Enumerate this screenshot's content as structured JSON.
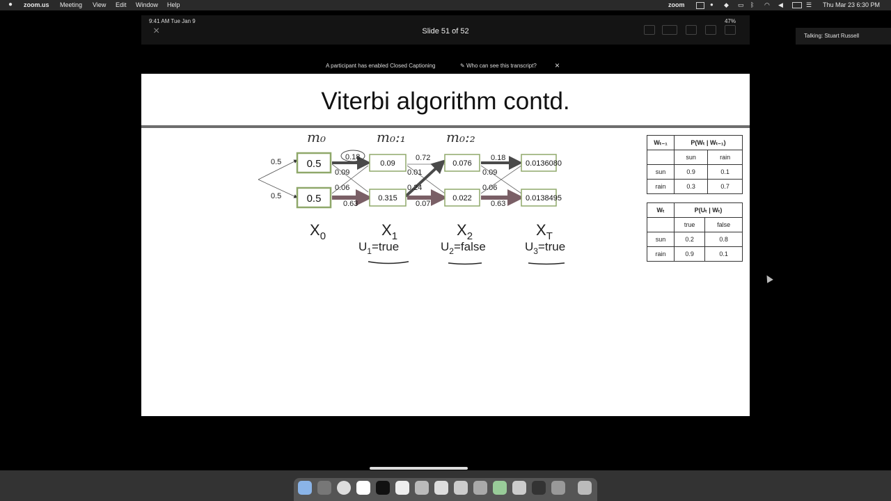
{
  "menubar": {
    "apple": "",
    "app": "zoom.us",
    "items": [
      "Meeting",
      "View",
      "Edit",
      "Window",
      "Help"
    ],
    "zoom_status": "zoom",
    "clock": "Thu Mar 23  6:30 PM"
  },
  "participant": {
    "talking": "Talking: Stuart Russell"
  },
  "ipad": {
    "time": "9:41 AM   Tue Jan 9",
    "slide_counter": "Slide 51 of 52",
    "battery": "47%",
    "close_icon": "×"
  },
  "caption_banner": {
    "message": "A participant has enabled Closed Captioning",
    "link": "Who can see this transcript?",
    "close": "×"
  },
  "slide": {
    "title": "Viterbi algorithm contd.",
    "handwritten_top": [
      "m₀",
      "m₀:₁",
      "m₀:₂"
    ],
    "init_probs": [
      "0.5",
      "0.5"
    ],
    "node_values_top": [
      "0.5",
      "0.09",
      "0.076",
      "0.0136080"
    ],
    "node_values_bottom": [
      "0.5",
      "0.315",
      "0.022",
      "0.0138495"
    ],
    "edges_1": {
      "ss": "0.18",
      "sr": "0.09",
      "rs": "0.06",
      "rr": "0.63"
    },
    "edges_2": {
      "ss": "0.72",
      "sr": "0.01",
      "rs": "0.24",
      "rr": "0.07"
    },
    "edges_3": {
      "ss": "0.18",
      "sr": "0.09",
      "rs": "0.06",
      "rr": "0.63"
    },
    "x_labels": [
      "X",
      "X",
      "X",
      "X"
    ],
    "x_subs": [
      "0",
      "1",
      "2",
      "T"
    ],
    "evidence": [
      {
        "var": "U",
        "sub": "1",
        "val": "=true"
      },
      {
        "var": "U",
        "sub": "2",
        "val": "=false"
      },
      {
        "var": "U",
        "sub": "3",
        "val": "=true"
      }
    ],
    "transition_table": {
      "header_left": "Wₜ₋₁",
      "header_right": "P(Wₜ | Wₜ₋₁)",
      "cols": [
        "sun",
        "rain"
      ],
      "rows": [
        {
          "label": "sun",
          "values": [
            "0.9",
            "0.1"
          ]
        },
        {
          "label": "rain",
          "values": [
            "0.3",
            "0.7"
          ]
        }
      ]
    },
    "sensor_table": {
      "header_left": "Wₜ",
      "header_right": "P(Uₜ | Wₜ)",
      "cols": [
        "true",
        "false"
      ],
      "rows": [
        {
          "label": "sun",
          "values": [
            "0.2",
            "0.8"
          ]
        },
        {
          "label": "rain",
          "values": [
            "0.9",
            "0.1"
          ]
        }
      ]
    }
  },
  "colors": {
    "node_border": "#8fa86a",
    "bold_arrow": "#4a4a4a",
    "path_arrow": "#7a5f66"
  },
  "dock_icons": [
    "finder-icon",
    "launchpad-icon",
    "chrome-icon",
    "slack-icon",
    "terminal-icon",
    "notes-icon",
    "messages-icon",
    "zoom-icon",
    "camera-icon",
    "preview-icon",
    "photos-icon",
    "app-icon",
    "pycharm-icon",
    "settings-icon",
    "trash-icon"
  ]
}
